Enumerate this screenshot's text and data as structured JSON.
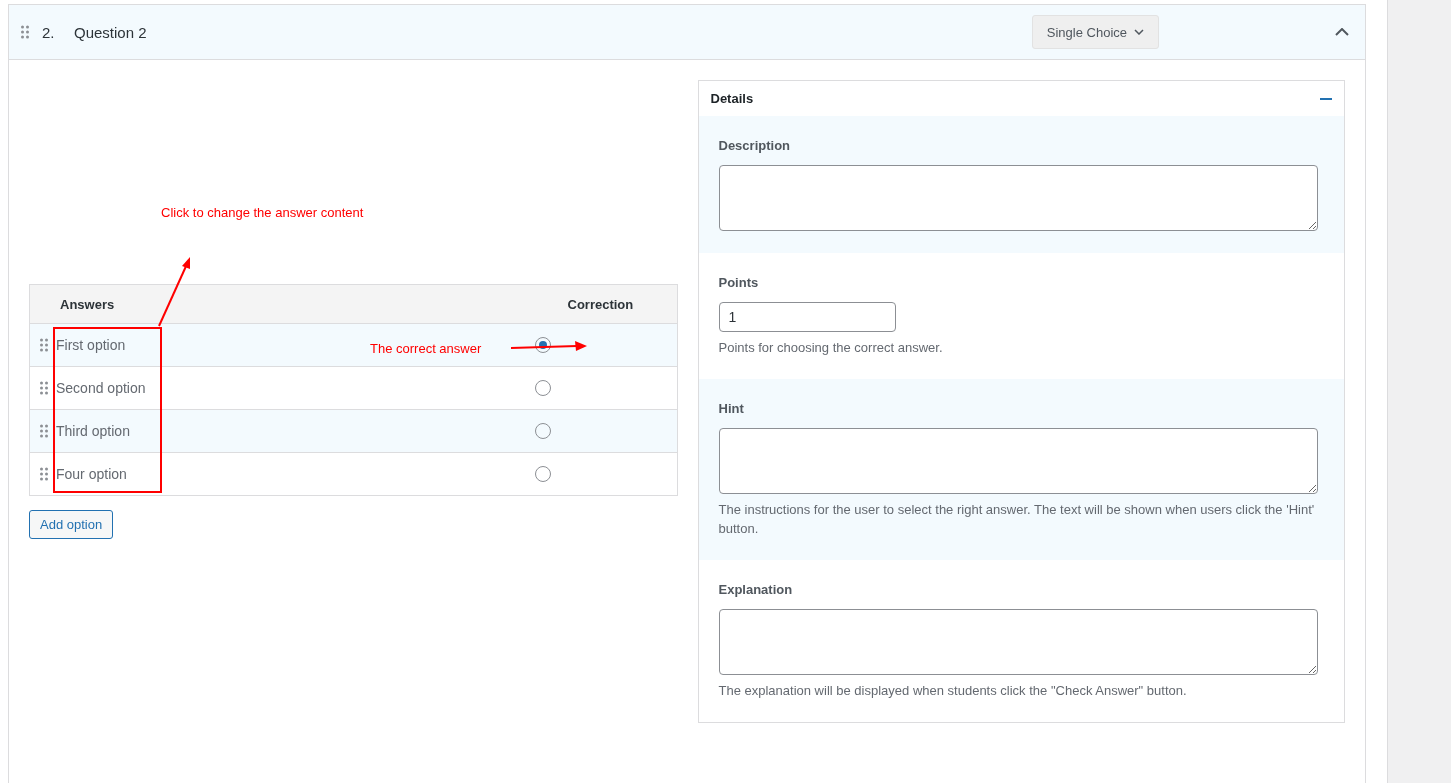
{
  "question": {
    "number": "2.",
    "title": "Question 2",
    "type": "Single Choice",
    "expanded": true
  },
  "answers": {
    "columns": [
      "Answers",
      "Correction"
    ],
    "rows": [
      {
        "text": "First option",
        "selected": true
      },
      {
        "text": "Second option",
        "selected": false
      },
      {
        "text": "Third option",
        "selected": false
      },
      {
        "text": "Four option",
        "selected": false
      }
    ],
    "add_button": "Add option"
  },
  "details": {
    "title": "Details",
    "expanded": true,
    "sections": [
      {
        "kind": "textarea",
        "label": "Description"
      },
      {
        "kind": "number",
        "label": "Points",
        "value": "1",
        "help": "Points for choosing the correct answer."
      },
      {
        "kind": "textarea",
        "label": "Hint",
        "help": "The instructions for the user to select the right answer. The text will be shown when users click the 'Hint' button."
      },
      {
        "kind": "textarea",
        "label": "Explanation",
        "help": "The explanation will be displayed when students click the \"Check Answer\" button."
      }
    ]
  },
  "annotations": [
    {
      "kind": "answer-box-callout",
      "text": "Click to change the answer content"
    },
    {
      "kind": "radio-callout",
      "text": "The correct answer"
    }
  ]
}
